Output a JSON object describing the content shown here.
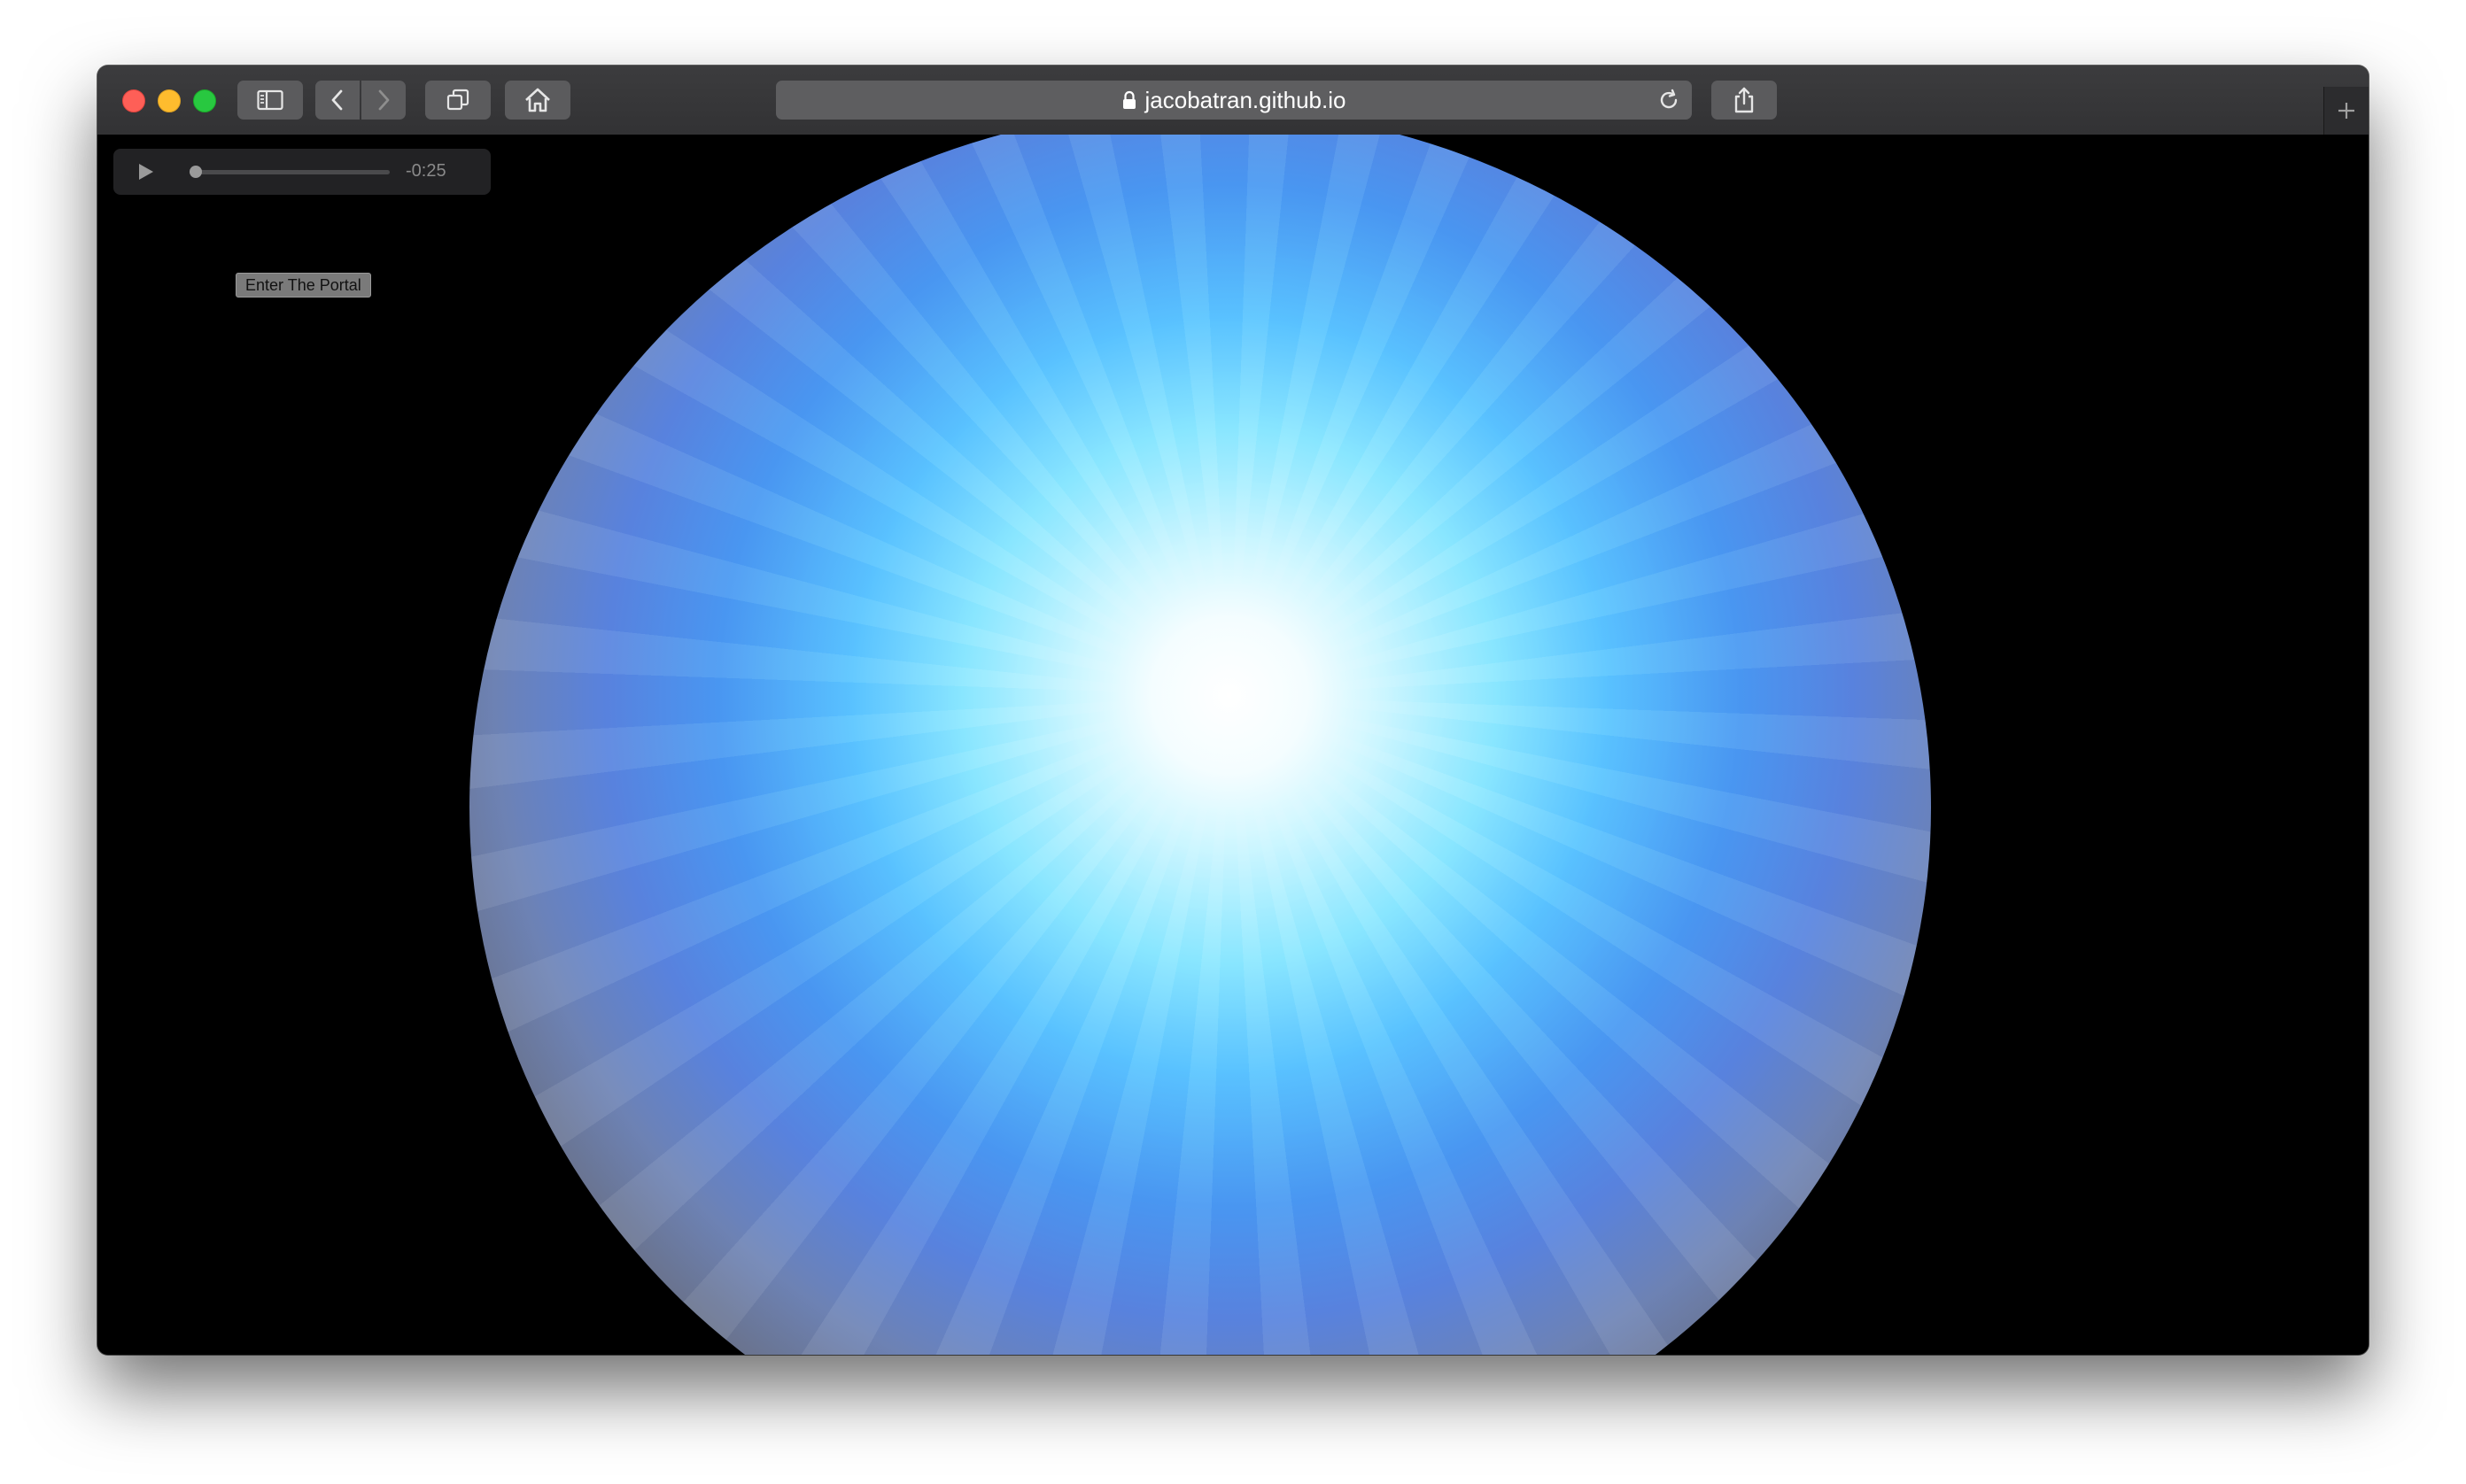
{
  "browser": {
    "url": "jacobatran.github.io",
    "icons": {
      "sidebar": "sidebar-icon",
      "back": "chevron-left-icon",
      "forward": "chevron-right-icon",
      "tabs": "tabs-overview-icon",
      "home": "home-icon",
      "lock": "lock-icon",
      "reload": "reload-icon",
      "share": "share-icon",
      "new_tab": "plus-icon"
    }
  },
  "page": {
    "player": {
      "time_remaining": "-0:25",
      "progress": 0.0
    },
    "portal_button_label": "Enter The Portal",
    "colors": {
      "background": "#000000",
      "orb_core": "#ffffff",
      "orb_glow": "#8fe8ff",
      "orb_mid": "#4f9cf2",
      "orb_edge": "#6f7890"
    }
  }
}
